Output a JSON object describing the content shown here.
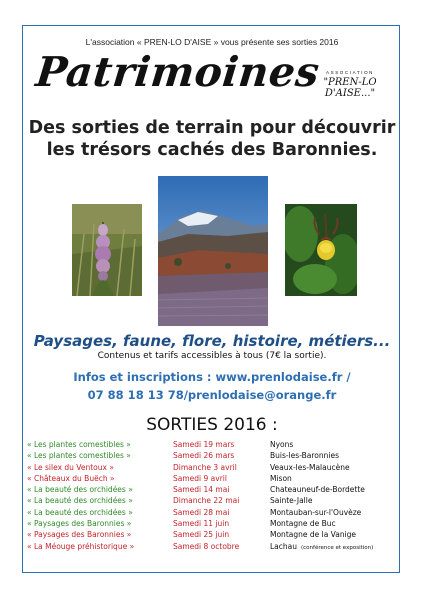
{
  "header": {
    "intro": "L'association « PREN-LO D'AISE » vous présente ses sorties 2016",
    "title": "Patrimoines",
    "assoc_label": "ASSOCIATION",
    "assoc_name": "\"PREN-LO D'AISE...\""
  },
  "subtitle": {
    "line1": "Des sorties de terrain pour découvrir",
    "line2": "les trésors cachés des Baronnies."
  },
  "tagline": "Paysages, faune, flore, histoire, métiers...",
  "pricing": "Contenus et tarifs accessibles à tous (7€ la sortie).",
  "info": {
    "line1": "Infos et inscriptions : www.prenlodaise.fr /",
    "line2": "07 88 18 13 78/prenlodaise@orange.fr"
  },
  "sorties": {
    "title": "SORTIES 2016 :",
    "rows": [
      {
        "name": "« Les plantes comestibles »",
        "date": "Samedi 19 mars",
        "place": "Nyons",
        "note": ""
      },
      {
        "name": "« Les plantes comestibles »",
        "date": "Samedi 26 mars",
        "place": "Buis-les-Baronnies",
        "note": ""
      },
      {
        "name": "« Le silex du Ventoux »",
        "date": "Dimanche 3 avril",
        "place": "Veaux-les-Malaucène",
        "note": ""
      },
      {
        "name": "« Châteaux du Buëch »",
        "date": "Samedi 9 avril",
        "place": "Mison",
        "note": ""
      },
      {
        "name": "« La beauté des orchidées »",
        "date": "Samedi 14 mai",
        "place": "Chateauneuf-de-Bordette",
        "note": ""
      },
      {
        "name": "« La beauté des orchidées »",
        "date": "Dimanche 22 mai",
        "place": "Sainte-Jalle",
        "note": ""
      },
      {
        "name": "« La beauté des orchidées »",
        "date": "Samedi 28 mai",
        "place": "Montauban-sur-l'Ouvèze",
        "note": ""
      },
      {
        "name": "« Paysages des Baronnies »",
        "date": "Samedi 11 juin",
        "place": "Montagne de Buc",
        "note": ""
      },
      {
        "name": "« Paysages des Baronnies »",
        "date": "Samedi 25 juin",
        "place": "Montagne de la Vanige",
        "note": ""
      },
      {
        "name": "« La Méouge préhistorique »",
        "date": "Samedi 8 octobre",
        "place": "Lachau",
        "note": "(conférence et exposition)"
      }
    ],
    "name_colors": [
      "green",
      "green",
      "red",
      "red",
      "green",
      "green",
      "green",
      "green",
      "red",
      "red"
    ]
  },
  "colors": {
    "frame": "#2e6fb4",
    "accent_blue": "#2e6fb4",
    "event_green": "#2f8a2a",
    "event_red": "#c4232a"
  }
}
